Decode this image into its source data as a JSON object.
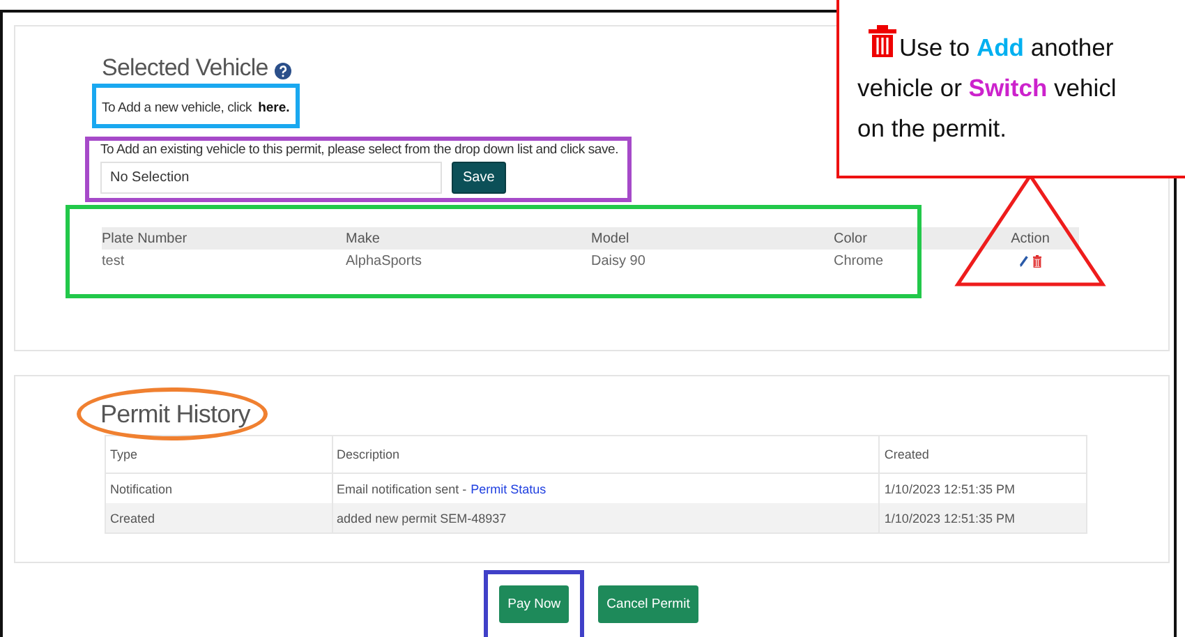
{
  "callout": {
    "lines": [
      [
        {
          "text": "Use to "
        },
        {
          "text": "Add",
          "color": "#00b0f0"
        },
        {
          "text": " another"
        }
      ],
      [
        {
          "text": "vehicle or "
        },
        {
          "text": "Switch",
          "color": "#cc22cc"
        },
        {
          "text": " vehicl"
        }
      ],
      [
        {
          "text": "on the permit."
        }
      ]
    ]
  },
  "selected_vehicle": {
    "title": "Selected Vehicle",
    "add_text": "To Add a new vehicle, click",
    "add_link": "here.",
    "existing_label": "To Add an existing vehicle to this permit, please select from the drop down list and click save.",
    "select_value": "No Selection",
    "save_button": "Save",
    "columns": [
      "Plate Number",
      "Make",
      "Model",
      "Color",
      "Action"
    ],
    "rows": [
      {
        "cells": [
          "test",
          "AlphaSports",
          "Daisy 90",
          "Chrome"
        ]
      }
    ]
  },
  "permit_history": {
    "title": "Permit History",
    "columns": [
      "Type",
      "Description",
      "Created"
    ],
    "rows": [
      {
        "type": "Notification",
        "description": "Email notification sent -",
        "link": "Permit Status",
        "created": "1/10/2023 12:51:35 PM"
      },
      {
        "type": "Created",
        "description": "added new permit SEM-48937",
        "created": "1/10/2023 12:51:35 PM"
      }
    ]
  },
  "buttons": [
    {
      "label": "Pay Now",
      "kind": "pay"
    },
    {
      "label": "Cancel Permit",
      "kind": "cancel"
    }
  ]
}
